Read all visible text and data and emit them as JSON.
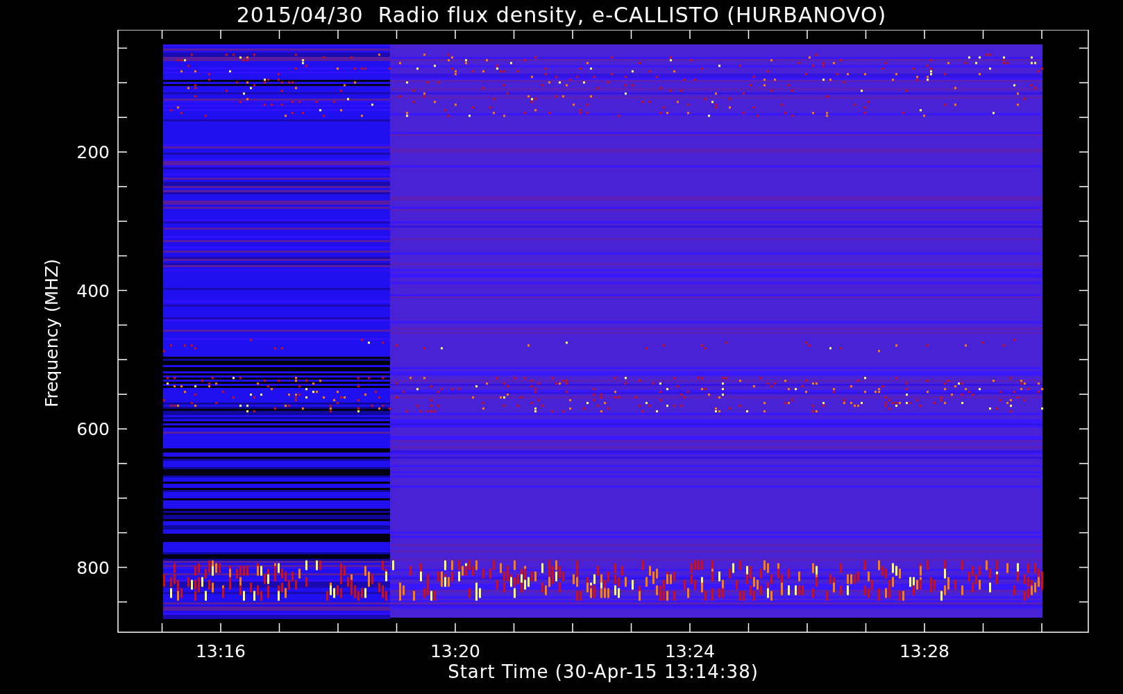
{
  "plot": {
    "title": "2015/04/30  Radio flux density, e-CALLISTO (HURBANOVO)",
    "ylabel": "Frequency (MHZ)",
    "xlabel": "Start Time (30-Apr-15 13:14:38)",
    "yticks": [
      "200",
      "400",
      "600",
      "800"
    ],
    "xticks": [
      "13:16",
      "13:20",
      "13:24",
      "13:28"
    ]
  }
}
